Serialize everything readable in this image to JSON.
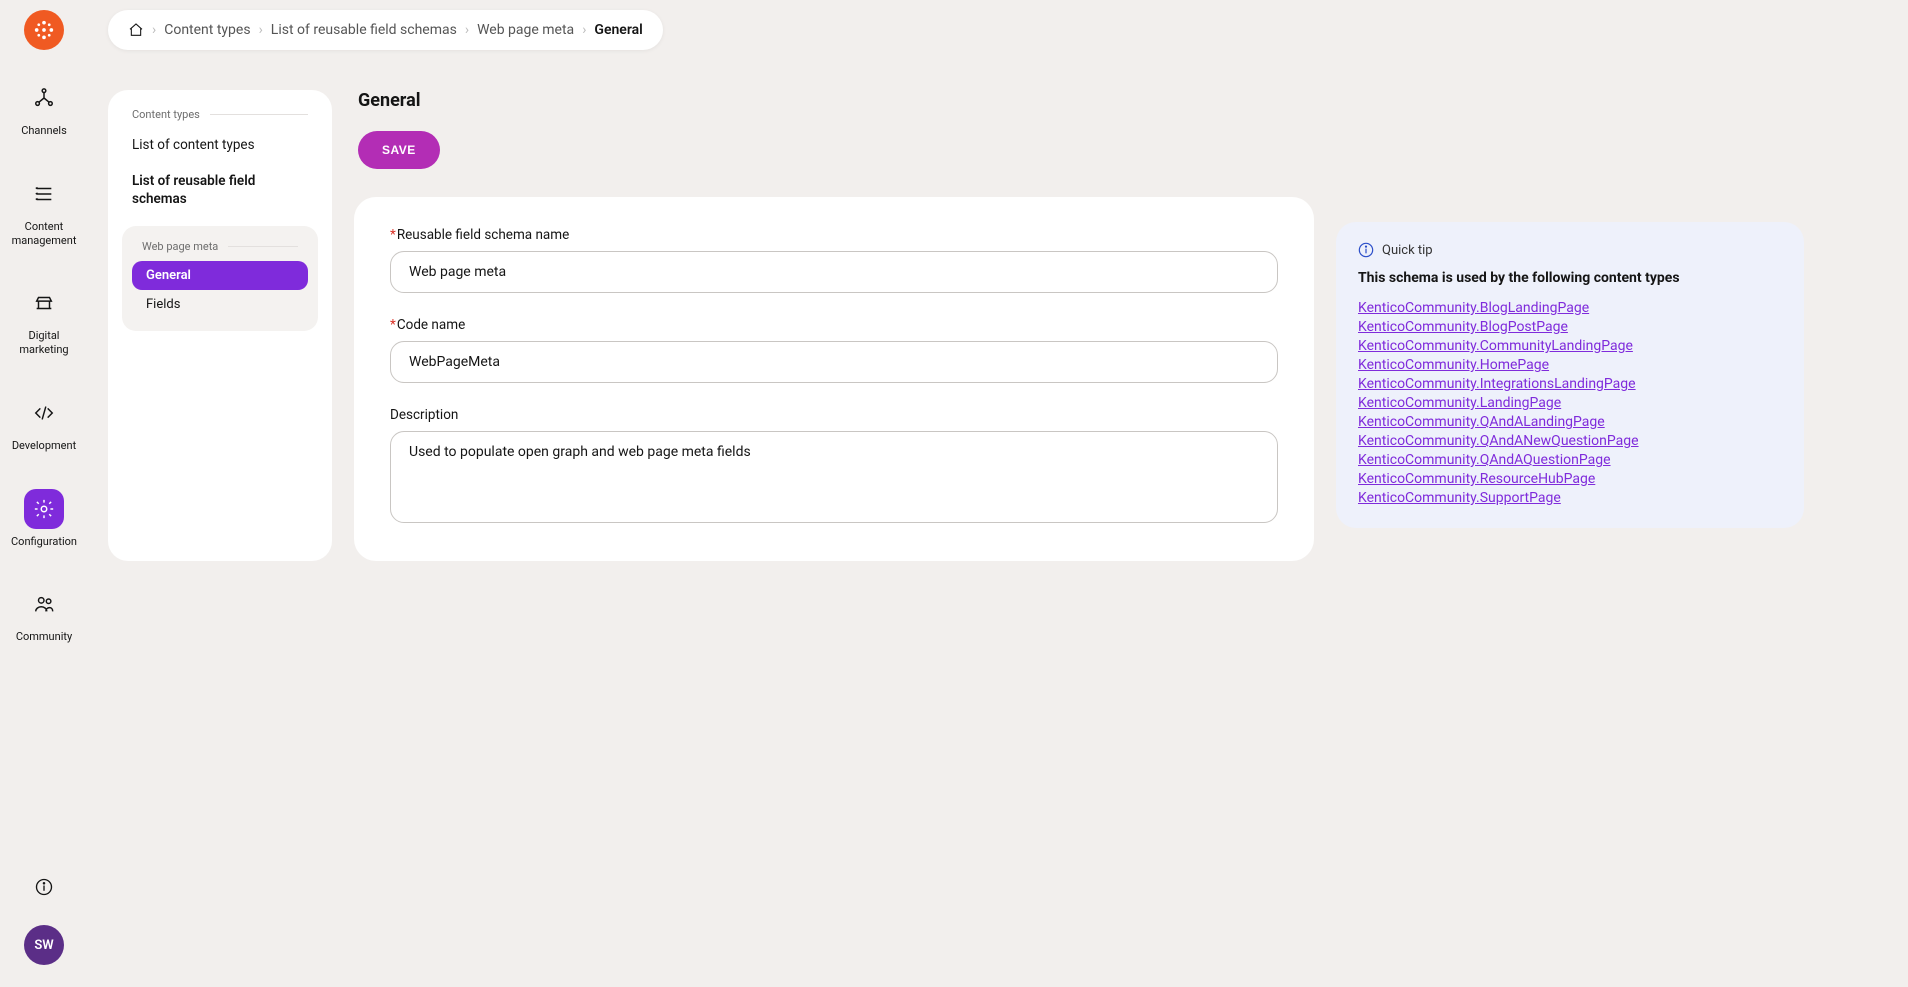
{
  "leftNav": {
    "items": [
      {
        "id": "channels",
        "label": "Channels"
      },
      {
        "id": "content-management",
        "label": "Content\nmanagement"
      },
      {
        "id": "digital-marketing",
        "label": "Digital\nmarketing"
      },
      {
        "id": "development",
        "label": "Development"
      },
      {
        "id": "configuration",
        "label": "Configuration"
      },
      {
        "id": "community",
        "label": "Community"
      }
    ],
    "avatarInitials": "SW"
  },
  "breadcrumb": {
    "items": [
      "Content types",
      "List of reusable field schemas",
      "Web page meta"
    ],
    "current": "General"
  },
  "sidePanel": {
    "sectionLabel": "Content types",
    "items": [
      "List of content types",
      "List of reusable field schemas"
    ],
    "subPanelLabel": "Web page meta",
    "subItems": [
      "General",
      "Fields"
    ]
  },
  "main": {
    "title": "General",
    "saveLabel": "SAVE",
    "fields": {
      "schemaNameLabel": "Reusable field schema name",
      "schemaNameValue": "Web page meta",
      "codeNameLabel": "Code name",
      "codeNameValue": "WebPageMeta",
      "descriptionLabel": "Description",
      "descriptionValue": "Used to populate open graph and web page meta fields"
    }
  },
  "tip": {
    "header": "Quick tip",
    "title": "This schema is used by the following content types",
    "links": [
      "KenticoCommunity.BlogLandingPage",
      "KenticoCommunity.BlogPostPage",
      "KenticoCommunity.CommunityLandingPage",
      "KenticoCommunity.HomePage",
      "KenticoCommunity.IntegrationsLandingPage",
      "KenticoCommunity.LandingPage",
      "KenticoCommunity.QAndALandingPage",
      "KenticoCommunity.QAndANewQuestionPage",
      "KenticoCommunity.QAndAQuestionPage",
      "KenticoCommunity.ResourceHubPage",
      "KenticoCommunity.SupportPage"
    ]
  }
}
